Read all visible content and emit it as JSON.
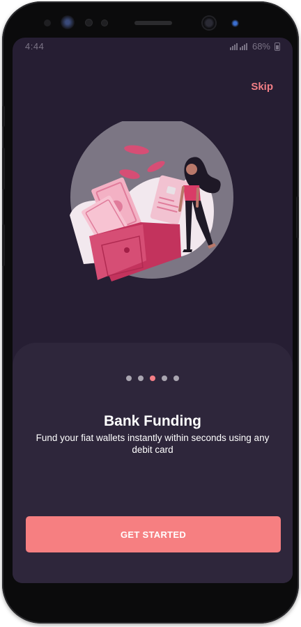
{
  "status_bar": {
    "time": "4:44",
    "battery": "68%"
  },
  "header": {
    "skip_label": "Skip"
  },
  "onboarding": {
    "title": "Bank Funding",
    "subtitle": "Fund your fiat wallets instantly within seconds using any debit card",
    "dots": [
      {
        "active": false
      },
      {
        "active": false
      },
      {
        "active": true
      },
      {
        "active": false
      },
      {
        "active": false
      }
    ],
    "current_page": 3,
    "page_count": 5
  },
  "cta": {
    "label": "GET STARTED"
  },
  "colors": {
    "background": "#261e33",
    "sheet": "#2e263b",
    "accent": "#f67f81",
    "illustration_circle": "#7c7684"
  },
  "icons": [
    "wallet-card-money-illustration",
    "signal-icon",
    "battery-icon"
  ]
}
